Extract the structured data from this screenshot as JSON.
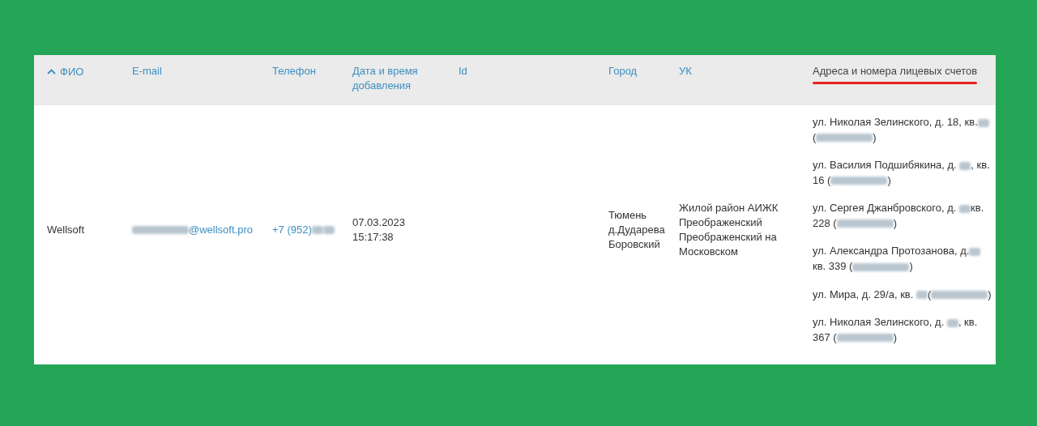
{
  "table": {
    "columns": [
      {
        "label": "ФИО",
        "sorted": true,
        "highlighted": false
      },
      {
        "label": "E-mail",
        "sorted": false,
        "highlighted": false
      },
      {
        "label": "Телефон",
        "sorted": false,
        "highlighted": false
      },
      {
        "label": "Дата и время добавления",
        "sorted": false,
        "highlighted": false
      },
      {
        "label": "Id",
        "sorted": false,
        "highlighted": false
      },
      {
        "label": "Город",
        "sorted": false,
        "highlighted": false
      },
      {
        "label": "УК",
        "sorted": false,
        "highlighted": false
      },
      {
        "label": "Адреса и номера лицевых счетов",
        "sorted": false,
        "highlighted": true
      }
    ],
    "rows": [
      {
        "name": "Wellsoft",
        "email": [
          {
            "kind": "redacted_long"
          },
          {
            "kind": "text",
            "text": "@wellsoft.pro"
          }
        ],
        "phone": [
          {
            "kind": "text",
            "text": "+7 (952) "
          },
          {
            "kind": "redacted_short"
          },
          {
            "kind": "redacted_short"
          }
        ],
        "added": "07.03.2023 15:17:38",
        "city": "Тюмень д.Дударева Боровский",
        "uk": "Жилой район АИЖК Преображенский Преображенский на Московском",
        "addresses": [
          [
            {
              "kind": "text",
              "text": "ул. Николая Зелинского, д. 18, кв. "
            },
            {
              "kind": "redacted_short"
            },
            {
              "kind": "text",
              "text": " ("
            },
            {
              "kind": "redacted_long"
            },
            {
              "kind": "text",
              "text": ")"
            }
          ],
          [
            {
              "kind": "text",
              "text": "ул. Василия Подшибякина, д. "
            },
            {
              "kind": "redacted_short"
            },
            {
              "kind": "text",
              "text": ", кв. 16 ("
            },
            {
              "kind": "redacted_long"
            },
            {
              "kind": "text",
              "text": ")"
            }
          ],
          [
            {
              "kind": "text",
              "text": "ул. Сергея Джанбровского, д. "
            },
            {
              "kind": "redacted_short"
            },
            {
              "kind": "text",
              "text": " кв. 228 ("
            },
            {
              "kind": "redacted_long"
            },
            {
              "kind": "text",
              "text": ")"
            }
          ],
          [
            {
              "kind": "text",
              "text": "ул. Александра Протозанова, д. "
            },
            {
              "kind": "redacted_short"
            },
            {
              "kind": "text",
              "text": " кв. 339 ("
            },
            {
              "kind": "redacted_long"
            },
            {
              "kind": "text",
              "text": ")"
            }
          ],
          [
            {
              "kind": "text",
              "text": "ул. Мира, д. 29/а, кв. "
            },
            {
              "kind": "redacted_short"
            },
            {
              "kind": "text",
              "text": " ("
            },
            {
              "kind": "redacted_long"
            },
            {
              "kind": "text",
              "text": ")"
            }
          ],
          [
            {
              "kind": "text",
              "text": "ул. Николая Зелинского, д. "
            },
            {
              "kind": "redacted_short"
            },
            {
              "kind": "text",
              "text": ", кв. 367 ("
            },
            {
              "kind": "redacted_long"
            },
            {
              "kind": "text",
              "text": ")"
            }
          ]
        ]
      }
    ]
  }
}
